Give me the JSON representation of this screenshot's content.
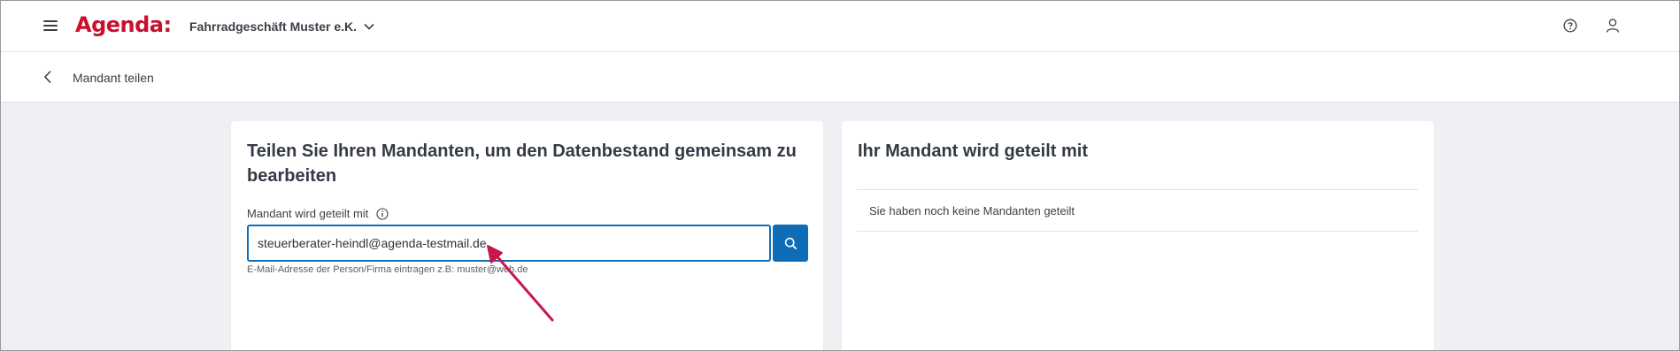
{
  "header": {
    "logo_text": "Agenda:",
    "company_name": "Fahrradgeschäft Muster e.K.",
    "brand_color": "#c8102e",
    "icons": [
      "menu-icon",
      "chevron-down-icon",
      "help-icon",
      "user-icon"
    ]
  },
  "subheader": {
    "title": "Mandant teilen",
    "icon": "back-chevron-icon"
  },
  "share_card": {
    "title": "Teilen Sie Ihren Mandanten, um den Datenbestand gemeinsam zu bearbeiten",
    "field_label": "Mandant wird geteilt mit",
    "field_value": "steuerberater-heindl@agenda-testmail.de",
    "hint": "E-Mail-Adresse der Person/Firma eintragen z.B: muster@web.de",
    "accent_color": "#0f6cb6"
  },
  "shared_card": {
    "title": "Ihr Mandant wird geteilt mit",
    "empty_text": "Sie haben noch keine Mandanten geteilt"
  },
  "annotation": {
    "arrow_color": "#c8174a"
  }
}
